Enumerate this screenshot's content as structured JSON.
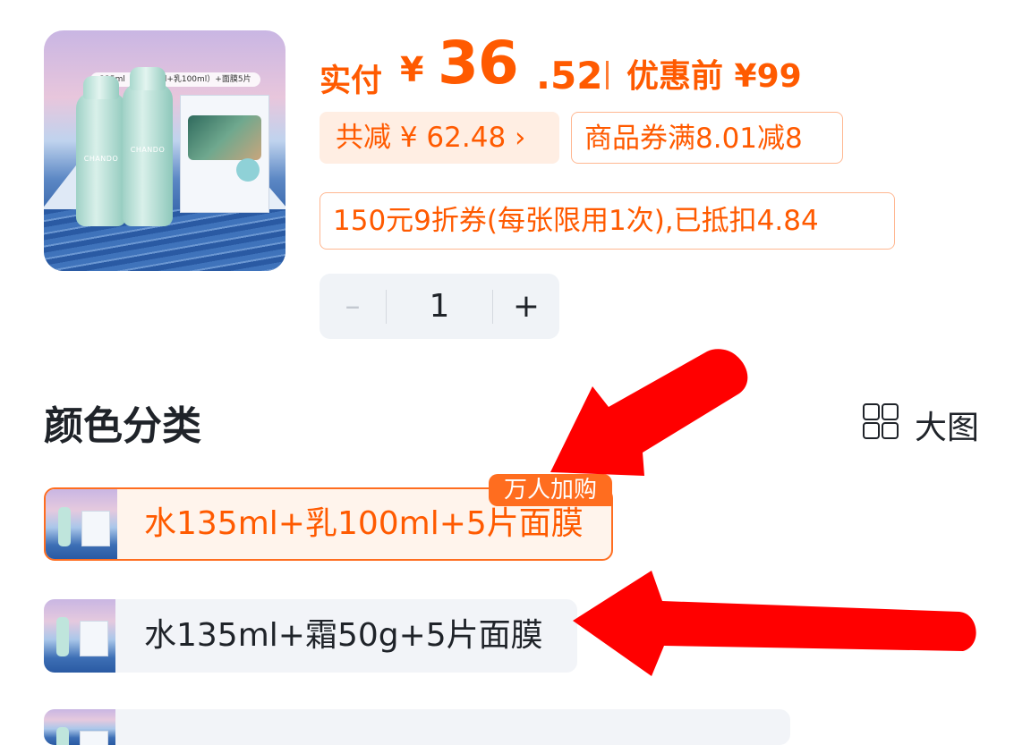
{
  "product": {
    "image_caption": "235ml（水135ml+乳100ml）+面膜5片",
    "brand": "CHANDO"
  },
  "price": {
    "paid_label": "实付",
    "currency": "¥",
    "integer": "36",
    "dot": ".",
    "decimal": "52",
    "before_label": "优惠前 ¥99"
  },
  "discounts": {
    "total_reduction": "共减 ¥ 62.48 ›",
    "coupon": "商品券满8.01减8",
    "voucher": "150元9折券(每张限用1次),已抵扣4.84"
  },
  "stepper": {
    "minus": "–",
    "quantity": "1",
    "plus": "+"
  },
  "section": {
    "title": "颜色分类",
    "view_toggle_label": "大图"
  },
  "options": [
    {
      "label": "水135ml+乳100ml+5片面膜",
      "badge": "万人加购",
      "selected": true
    },
    {
      "label": "水135ml+霜50g+5片面膜",
      "selected": false
    },
    {
      "label": "",
      "selected": false
    }
  ],
  "colors": {
    "accent": "#ff5a00",
    "tag_bg": "#ffeee3",
    "selected_border": "#ff6d1f",
    "annotation_arrow": "#ff0000"
  },
  "icons": [
    "grid-view-icon",
    "annotation-arrow"
  ]
}
